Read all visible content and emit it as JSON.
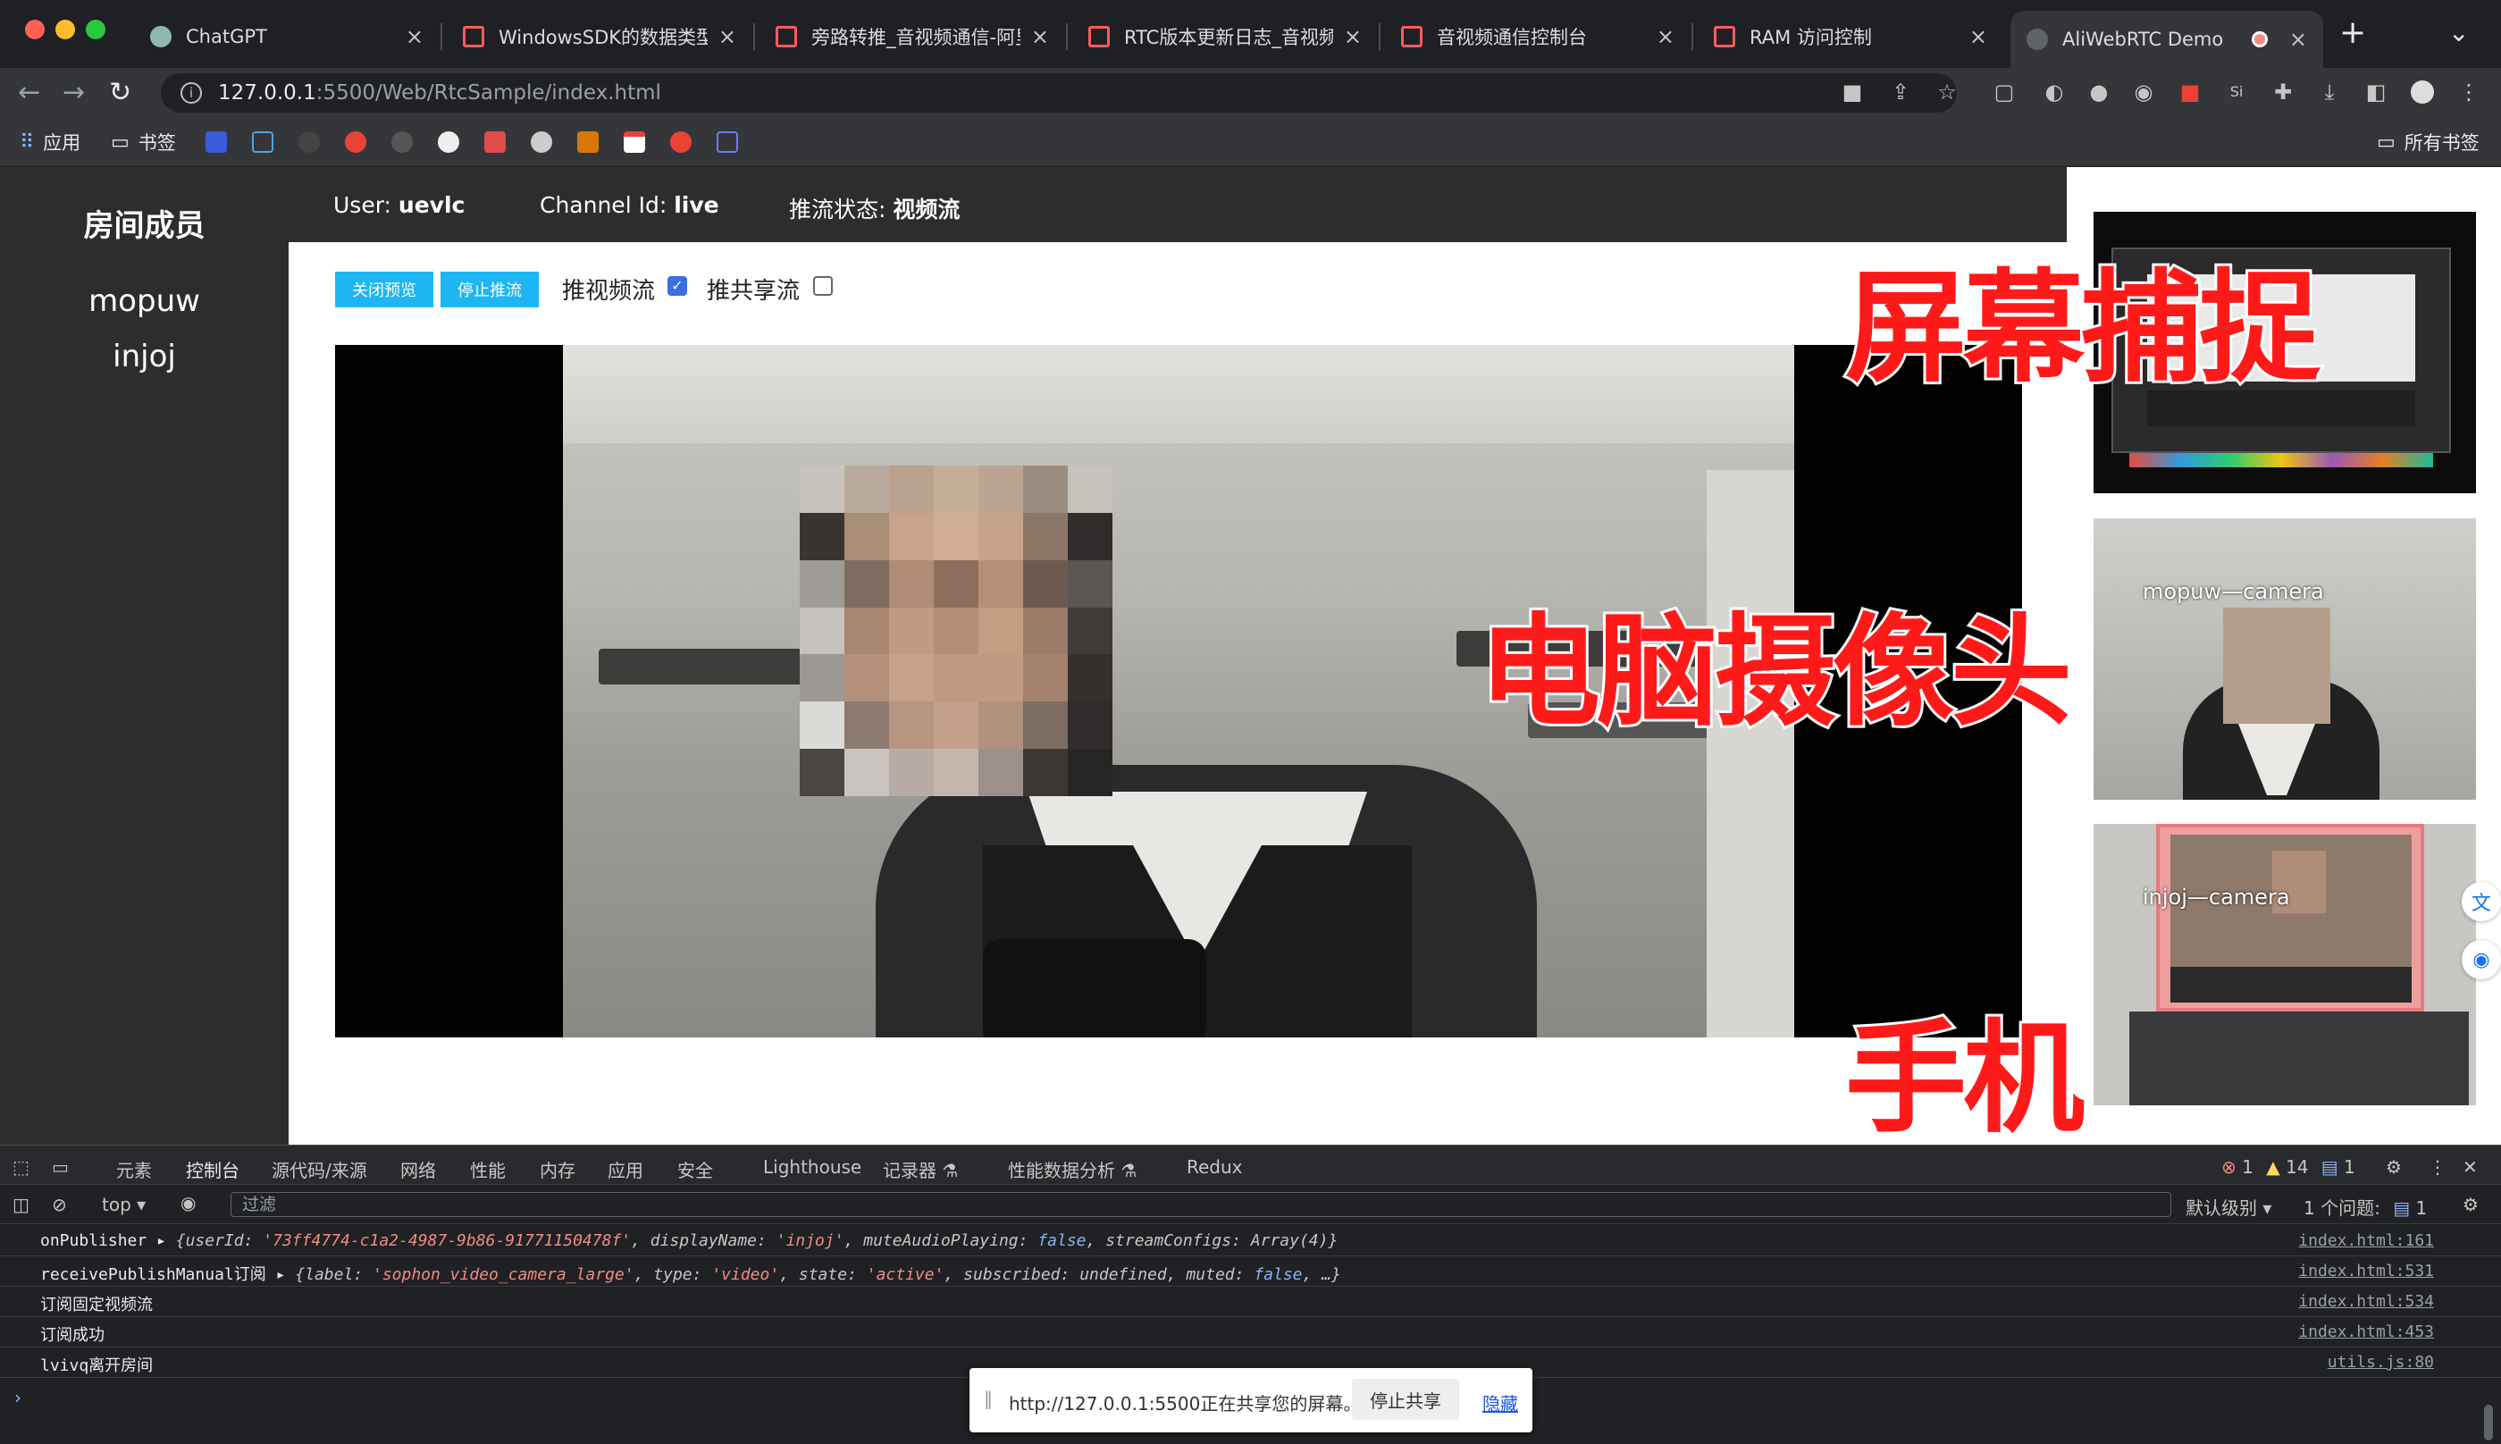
{
  "browser": {
    "tabs": [
      {
        "title": "ChatGPT",
        "icon": "chatgpt-icon"
      },
      {
        "title": "WindowsSDK的数据类型_i",
        "icon": "aliyun-icon"
      },
      {
        "title": "旁路转推_音视频通信-阿里",
        "icon": "aliyun-icon"
      },
      {
        "title": "RTC版本更新日志_音视频通",
        "icon": "aliyun-icon"
      },
      {
        "title": "音视频通信控制台",
        "icon": "aliyun-icon"
      },
      {
        "title": "RAM 访问控制",
        "icon": "aliyun-icon"
      },
      {
        "title": "AliWebRTC Demo",
        "icon": "globe-icon",
        "active": true
      }
    ],
    "url_host": "127.0.0.1",
    "url_path": ":5500/Web/RtcSample/index.html",
    "bookmarks": {
      "apps": "应用",
      "bookmarks": "书签",
      "all": "所有书签"
    }
  },
  "page": {
    "sidebar": {
      "title": "房间成员",
      "members": [
        "mopuw",
        "injoj"
      ]
    },
    "info": {
      "user_label": "User:",
      "user_value": "uevlc",
      "channel_label": "Channel Id:",
      "channel_value": "live",
      "status_label": "推流状态:",
      "status_value": "视频流"
    },
    "controls": {
      "close_preview": "关闭预览",
      "stop_push": "停止推流",
      "push_video_label": "推视频流",
      "push_video_checked": true,
      "push_share_label": "推共享流",
      "push_share_checked": false
    },
    "thumbnails": [
      {
        "label": ""
      },
      {
        "label": "mopuw—camera"
      },
      {
        "label": "injoj—camera"
      }
    ],
    "overlays": [
      "屏幕捕捉",
      "电脑摄像头",
      "手机"
    ]
  },
  "devtools": {
    "tabs": [
      "元素",
      "控制台",
      "源代码/来源",
      "网络",
      "性能",
      "内存",
      "应用",
      "安全",
      "Lighthouse",
      "记录器 ⚗",
      "性能数据分析 ⚗",
      "Redux"
    ],
    "active_tab": "控制台",
    "errors": "1",
    "warnings": "14",
    "infos": "1",
    "context": "top",
    "filter_placeholder": "过滤",
    "level": "默认级别",
    "issues_label": "1 个问题:",
    "issues_count": "1",
    "console": [
      {
        "prefix": "onPublisher",
        "src": "index.html:161"
      },
      {
        "prefix": "receivePublishManual订阅",
        "src": "index.html:531"
      },
      {
        "prefix": "订阅固定视频流",
        "src": "index.html:534"
      },
      {
        "prefix": "订阅成功",
        "src": "index.html:453"
      },
      {
        "prefix": "lvivq离开房间",
        "src": "utils.js:80"
      }
    ],
    "line1": {
      "k1": "userId",
      "v1": "'73ff4774-c1a2-4987-9b86-91771150478f'",
      "k2": "displayName",
      "v2": "'injoj'",
      "k3": "muteAudioPlaying",
      "v3": "false",
      "k4": "streamConfigs",
      "v4": "Array(4)"
    },
    "line2": {
      "k1": "label",
      "v1": "'sophon_video_camera_large'",
      "k2": "type",
      "v2": "'video'",
      "k3": "state",
      "v3": "'active'",
      "k4": "subscribed",
      "v4": "undefined",
      "k5": "muted",
      "v5": "false"
    }
  },
  "share_bar": {
    "text": "http://127.0.0.1:5500正在共享您的屏幕。",
    "stop": "停止共享",
    "hide": "隐藏"
  }
}
